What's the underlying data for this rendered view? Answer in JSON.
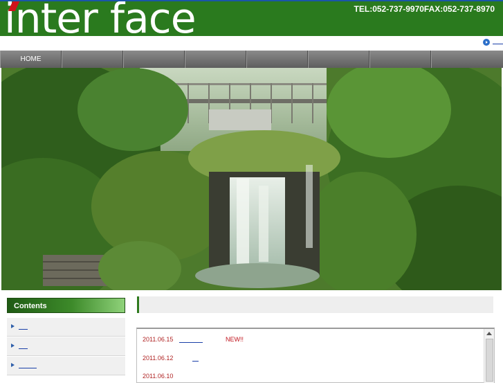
{
  "header": {
    "logo_text": "inter face",
    "contact": "TEL:052-737-9970FAX:052-737-8970"
  },
  "nav": {
    "items": [
      {
        "label": "HOME"
      },
      {
        "label": ""
      },
      {
        "label": ""
      },
      {
        "label": ""
      },
      {
        "label": ""
      },
      {
        "label": ""
      },
      {
        "label": ""
      },
      {
        "label": ""
      }
    ]
  },
  "hero": {
    "alt": "forest waterfall with footbridge"
  },
  "sidebar": {
    "heading": "Contents",
    "items": [
      {
        "label": ""
      },
      {
        "label": ""
      },
      {
        "label": ""
      }
    ]
  },
  "news": {
    "items": [
      {
        "date": "2011.06.15",
        "badge": "NEW!!"
      },
      {
        "date": "2011.06.12",
        "badge": ""
      },
      {
        "date": "2011.06.10",
        "badge": ""
      }
    ]
  },
  "colors": {
    "brand_green": "#2a7a1e",
    "nav_gray": "#6e6e6e",
    "news_red": "#b02424"
  }
}
